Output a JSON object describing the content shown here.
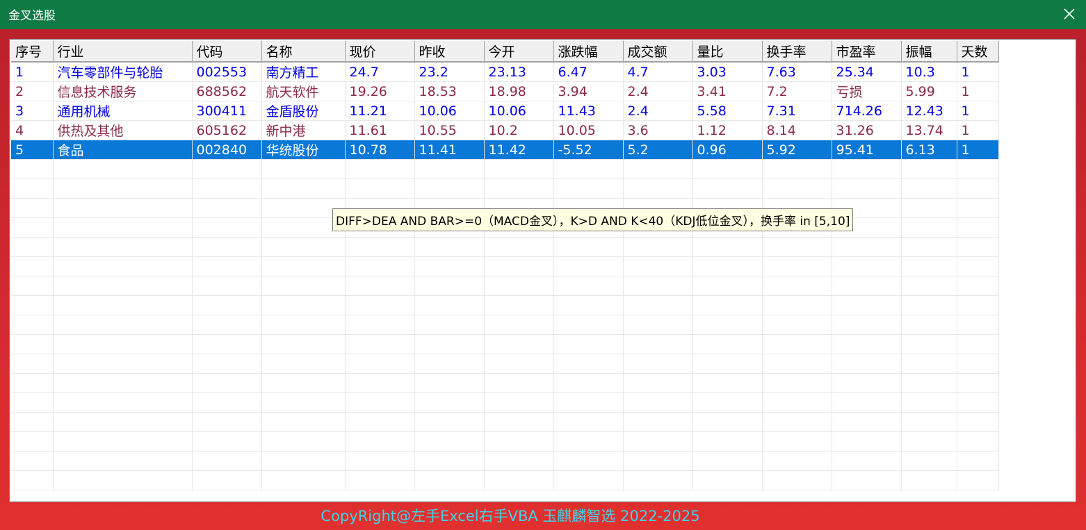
{
  "window": {
    "title": "金叉选股"
  },
  "table": {
    "columns": [
      "序号",
      "行业",
      "代码",
      "名称",
      "现价",
      "昨收",
      "今开",
      "涨跌幅",
      "成交额",
      "量比",
      "换手率",
      "市盈率",
      "振幅",
      "天数"
    ],
    "rows": [
      {
        "style": "blue",
        "cells": [
          "1",
          "汽车零部件与轮胎",
          "002553",
          "南方精工",
          "24.7",
          "23.2",
          "23.13",
          "6.47",
          "4.7",
          "3.03",
          "7.63",
          "25.34",
          "10.3",
          "1"
        ]
      },
      {
        "style": "maroon",
        "cells": [
          "2",
          "信息技术服务",
          "688562",
          "航天软件",
          "19.26",
          "18.53",
          "18.98",
          "3.94",
          "2.4",
          "3.41",
          "7.2",
          "亏损",
          "5.99",
          "1"
        ]
      },
      {
        "style": "blue",
        "cells": [
          "3",
          "通用机械",
          "300411",
          "金盾股份",
          "11.21",
          "10.06",
          "10.06",
          "11.43",
          "2.4",
          "5.58",
          "7.31",
          "714.26",
          "12.43",
          "1"
        ]
      },
      {
        "style": "maroon",
        "cells": [
          "4",
          "供热及其他",
          "605162",
          "新中港",
          "11.61",
          "10.55",
          "10.2",
          "10.05",
          "3.6",
          "1.12",
          "8.14",
          "31.26",
          "13.74",
          "1"
        ]
      },
      {
        "style": "sel",
        "cells": [
          "5",
          "食品",
          "002840",
          "华统股份",
          "10.78",
          "11.41",
          "11.42",
          "-5.52",
          "5.2",
          "0.96",
          "5.92",
          "95.41",
          "6.13",
          "1"
        ]
      }
    ],
    "empty_rows": 17
  },
  "tooltip": "DIFF>DEA AND BAR>=0（MACD金叉），K>D AND K<40（KDJ低位金叉），换手率 in [5,10]",
  "footer": "CopyRight@左手Excel右手VBA 玉麒麟智选  2022-2025",
  "colors": {
    "titlebar": "#0f7a44",
    "selected_row": "#0a78d7",
    "row_blue": "#0000e0",
    "row_maroon": "#8a2a4a",
    "footer_text": "#3fd4e6"
  }
}
